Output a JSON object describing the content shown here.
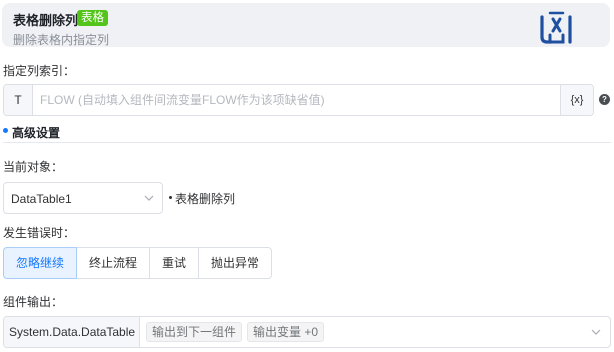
{
  "header": {
    "title": "表格删除列",
    "tag": "表格",
    "description": "删除表格内指定列",
    "logo_icon": "uibot-logo-icon",
    "accent_color": "#1f4fa0",
    "tag_color": "#52c41a"
  },
  "column_index": {
    "label": "指定列索引：",
    "prefix": "T",
    "placeholder": "FLOW (自动填入组件间流变量FLOW作为该项缺省值)",
    "value": "",
    "suffix": "{x}",
    "help_icon": "question-circle-icon"
  },
  "advanced": {
    "title": "高级设置",
    "accent_color": "#1677ff"
  },
  "current_object": {
    "label": "当前对象：",
    "selected": "DataTable1",
    "object_label": "表格删除列"
  },
  "on_error": {
    "label": "发生错误时：",
    "options": [
      "忽略继续",
      "终止流程",
      "重试",
      "抛出异常"
    ],
    "selected_index": 0
  },
  "output": {
    "label": "组件输出：",
    "type": "System.Data.DataTable",
    "tags": [
      "输出到下一组件",
      "输出变量 +0"
    ]
  }
}
